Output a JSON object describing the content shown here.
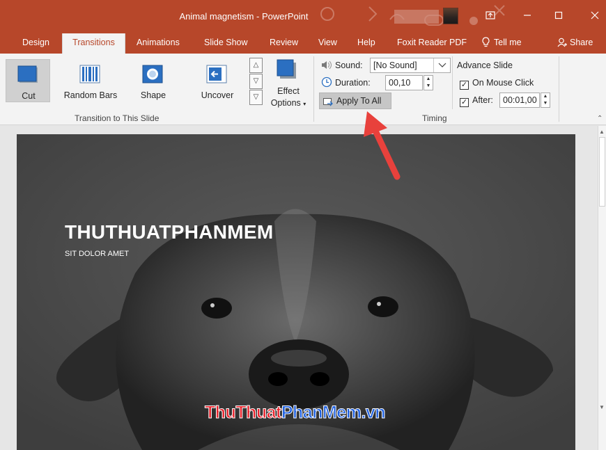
{
  "window": {
    "title": "Animal magnetism  -  PowerPoint",
    "minimize_icon": "minimize-icon",
    "maximize_icon": "maximize-icon",
    "close_icon": "close-icon",
    "ribbon_display_icon": "ribbon-display-options-icon"
  },
  "menu": {
    "tabs": [
      {
        "label": "Design"
      },
      {
        "label": "Transitions",
        "active": true
      },
      {
        "label": "Animations"
      },
      {
        "label": "Slide Show"
      },
      {
        "label": "Review"
      },
      {
        "label": "View"
      },
      {
        "label": "Help"
      },
      {
        "label": "Foxit Reader PDF"
      }
    ],
    "tell_me": "Tell me",
    "share": "Share"
  },
  "ribbon": {
    "transition_gallery": [
      {
        "label": "Cut",
        "icon": "cut-transition-icon",
        "selected": true
      },
      {
        "label": "Random Bars",
        "icon": "random-bars-icon"
      },
      {
        "label": "Shape",
        "icon": "shape-transition-icon"
      },
      {
        "label": "Uncover",
        "icon": "uncover-transition-icon"
      }
    ],
    "effect_options": {
      "line1": "Effect",
      "line2": "Options"
    },
    "group_transition_label": "Transition to This Slide",
    "timing": {
      "sound_label": "Sound:",
      "sound_value": "[No Sound]",
      "duration_label": "Duration:",
      "duration_value": "00,10",
      "apply_to_all": "Apply To All",
      "advance_slide": "Advance Slide",
      "on_mouse_click": "On Mouse Click",
      "on_mouse_click_checked": true,
      "after_label": "After:",
      "after_checked": true,
      "after_value": "00:01,00",
      "group_label": "Timing"
    }
  },
  "slide": {
    "title": "THUTHUATPHANMEM",
    "subtitle": "SIT DOLOR AMET",
    "watermark_part1": "ThuThuat",
    "watermark_part2": "PhanMem",
    "watermark_part3": ".vn"
  },
  "colors": {
    "titlebar": "#b7472a",
    "arrow": "#e8413c",
    "watermark_red": "#e8232c",
    "watermark_blue": "#1d5fe0"
  }
}
